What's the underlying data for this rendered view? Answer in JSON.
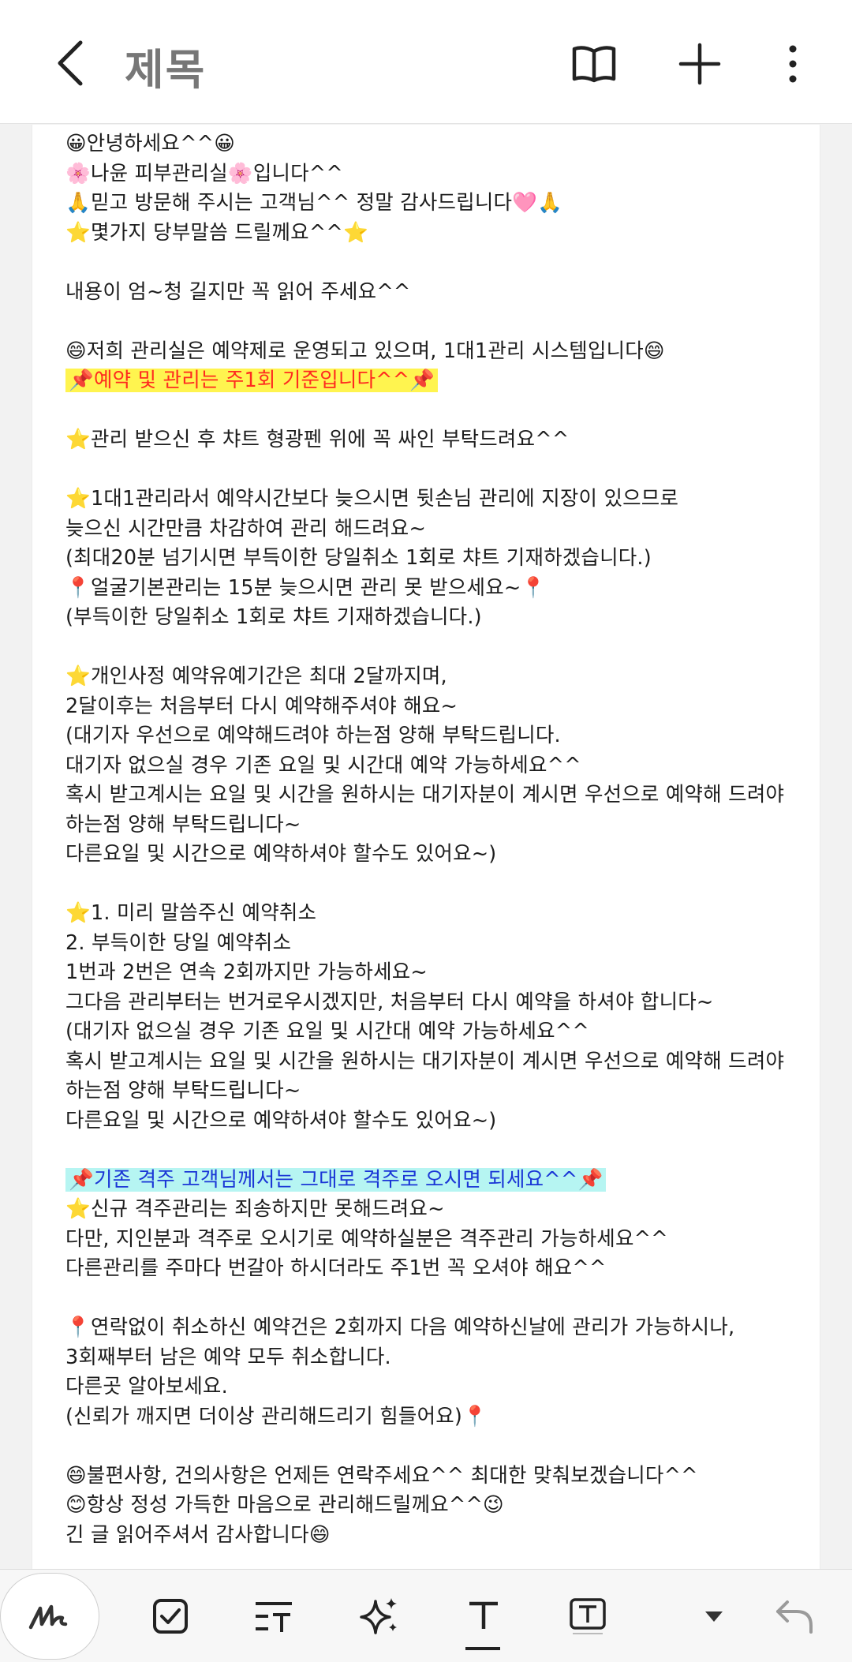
{
  "header": {
    "title": "제목",
    "icons": [
      "back-arrow-icon",
      "book-icon",
      "plus-icon",
      "more-vert-icon"
    ]
  },
  "note": {
    "lines": [
      {
        "text": "😀안녕하세요^^😀",
        "style": ""
      },
      {
        "text": "🌸나윤 피부관리실🌸입니다^^",
        "style": ""
      },
      {
        "text": "🙏믿고 방문해 주시는 고객님^^ 정말 감사드립니다🩷🙏",
        "style": ""
      },
      {
        "text": "⭐몇가지 당부말씀 드릴께요^^⭐",
        "style": ""
      },
      {
        "text": "",
        "style": ""
      },
      {
        "text": "내용이 엄~청 길지만 꼭 읽어 주세요^^",
        "style": ""
      },
      {
        "text": "",
        "style": ""
      },
      {
        "text": "😄저희 관리실은 예약제로 운영되고 있으며, 1대1관리 시스템입니다😄",
        "style": ""
      },
      {
        "text": "📌예약 및 관리는 주1회 기준입니다^^📌",
        "style": "yellow"
      },
      {
        "text": "",
        "style": ""
      },
      {
        "text": "⭐관리 받으신 후 챠트 형광펜 위에 꼭 싸인 부탁드려요^^",
        "style": ""
      },
      {
        "text": "",
        "style": ""
      },
      {
        "text": "⭐1대1관리라서 예약시간보다 늦으시면 뒷손님 관리에 지장이 있으므로",
        "style": ""
      },
      {
        "text": "   늦으신 시간만큼 차감하여 관리 해드려요~",
        "style": ""
      },
      {
        "text": "(최대20분 넘기시면 부득이한 당일취소 1회로 챠트 기재하겠습니다.)",
        "style": ""
      },
      {
        "text": "📍얼굴기본관리는 15분 늦으시면 관리 못 받으세요~📍",
        "style": ""
      },
      {
        "text": "(부득이한 당일취소 1회로 챠트 기재하겠습니다.)",
        "style": ""
      },
      {
        "text": "",
        "style": ""
      },
      {
        "text": "⭐개인사정 예약유예기간은 최대 2달까지며,",
        "style": ""
      },
      {
        "text": "2달이후는 처음부터 다시 예약해주셔야 해요~",
        "style": ""
      },
      {
        "text": "(대기자 우선으로 예약해드려야 하는점 양해 부탁드립니다.",
        "style": ""
      },
      {
        "text": "대기자 없으실 경우 기존 요일 및 시간대 예약 가능하세요^^",
        "style": ""
      },
      {
        "text": "혹시 받고계시는 요일 및 시간을 원하시는 대기자분이 계시면 우선으로 예약해 드려야",
        "style": ""
      },
      {
        "text": "하는점 양해 부탁드립니다~",
        "style": ""
      },
      {
        "text": "다른요일 및 시간으로 예약하셔야 할수도 있어요~)",
        "style": ""
      },
      {
        "text": "",
        "style": ""
      },
      {
        "text": "⭐1. 미리 말씀주신 예약취소",
        "style": ""
      },
      {
        "text": "    2. 부득이한 당일 예약취소",
        "style": ""
      },
      {
        "text": "1번과 2번은 연속 2회까지만 가능하세요~",
        "style": ""
      },
      {
        "text": "그다음 관리부터는 번거로우시겠지만, 처음부터 다시 예약을 하셔야 합니다~",
        "style": ""
      },
      {
        "text": "(대기자 없으실 경우 기존 요일 및 시간대 예약 가능하세요^^",
        "style": ""
      },
      {
        "text": "혹시 받고계시는 요일 및 시간을 원하시는 대기자분이 계시면 우선으로 예약해 드려야",
        "style": ""
      },
      {
        "text": "하는점 양해 부탁드립니다~",
        "style": ""
      },
      {
        "text": "다른요일 및 시간으로 예약하셔야 할수도 있어요~)",
        "style": ""
      },
      {
        "text": "",
        "style": ""
      },
      {
        "text": "📌기존 격주 고객님께서는 그대로 격주로 오시면 되세요^^📌",
        "style": "cyan"
      },
      {
        "text": "⭐신규 격주관리는 죄송하지만 못해드려요~",
        "style": ""
      },
      {
        "text": "다만, 지인분과 격주로 오시기로 예약하실분은 격주관리 가능하세요^^",
        "style": ""
      },
      {
        "text": "다른관리를 주마다 번갈아 하시더라도 주1번 꼭 오셔야 해요^^",
        "style": ""
      },
      {
        "text": "",
        "style": ""
      },
      {
        "text": "📍연락없이 취소하신 예약건은 2회까지 다음 예약하신날에 관리가 가능하시나,",
        "style": ""
      },
      {
        "text": "    3회째부터 남은 예약 모두 취소합니다.",
        "style": ""
      },
      {
        "text": "    다른곳 알아보세요.",
        "style": ""
      },
      {
        "text": "(신뢰가 깨지면 더이상 관리해드리기 힘들어요)📍",
        "style": ""
      },
      {
        "text": "",
        "style": ""
      },
      {
        "text": "😄불편사항, 건의사항은 언제든 연락주세요^^ 최대한 맞춰보겠습니다^^",
        "style": ""
      },
      {
        "text": "😊항상 정성 가득한 마음으로 관리해드릴께요^^😉",
        "style": ""
      },
      {
        "text": "긴 글 읽어주셔서 감사합니다😄",
        "style": ""
      }
    ]
  },
  "toolbar": {
    "icons": [
      "handwriting-pen-icon",
      "checkbox-icon",
      "text-format-icon",
      "sparkle-ai-icon",
      "text-style-icon",
      "text-box-icon",
      "dropdown-arrow-icon",
      "undo-icon"
    ]
  },
  "colors": {
    "highlight_yellow": "#fff44f",
    "highlight_yellow_text": "#ff2a1f",
    "highlight_cyan": "#b6f5f2",
    "highlight_cyan_text": "#1a36d6"
  }
}
